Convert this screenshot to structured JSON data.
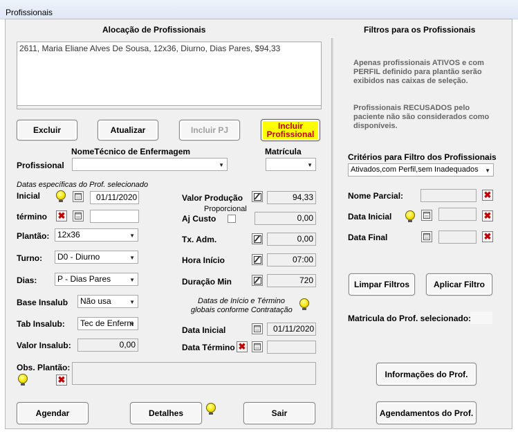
{
  "window": {
    "title": "Profissionais"
  },
  "alloc": {
    "heading": "Alocação de Profissionais",
    "list_item": "2611, Maria Eliane Alves De Sousa, 12x36, Diurno, Dias Pares, $94,33"
  },
  "buttons": {
    "excluir": "Excluir",
    "atualizar": "Atualizar",
    "incluir_pj": "Incluir PJ",
    "incluir_prof_1": "Incluir",
    "incluir_prof_2": "Profissional",
    "agendar": "Agendar",
    "detalhes": "Detalhes",
    "sair": "Sair",
    "limpar_filtros": "Limpar Filtros",
    "aplicar_filtro": "Aplicar Filtro",
    "info_prof": "Informações do Prof.",
    "agend_prof": "Agendamentos do Prof."
  },
  "form": {
    "nome_tecnico": "NomeTécnico de Enfermagem",
    "profissional": "Profissional",
    "matricula": "Matrícula",
    "datas_especificas": "Datas específicas do Prof. selecionado",
    "inicial": "Inicial",
    "inicial_value": "01/11/2020",
    "termino": "término",
    "termino_value": "",
    "plantao": "Plantão:",
    "plantao_value": "12x36",
    "turno": "Turno:",
    "turno_value": "D0 - Diurno",
    "dias": "Dias:",
    "dias_value": "P - Dias Pares",
    "base_insalub": "Base Insalub",
    "base_insalub_value": "Não usa",
    "tab_insalub": "Tab Insalub:",
    "tab_insalub_value": "Tec de Enferm",
    "valor_insalub": "Valor Insalub:",
    "valor_insalub_value": "0,00",
    "obs_plantao": "Obs. Plantão:",
    "valor_producao": "Valor Produção",
    "valor_producao_value": "94,33",
    "proporcional": "Proporcional",
    "aj_custo": "Aj Custo",
    "aj_custo_value": "0,00",
    "tx_adm": "Tx. Adm.",
    "tx_adm_value": "0,00",
    "hora_inicio": "Hora Início",
    "hora_inicio_value": "07:00",
    "duracao_min": "Duração Min",
    "duracao_min_value": "720",
    "datas_globais_1": "Datas de Início e Término",
    "datas_globais_2": "globais conforme Contratação",
    "data_inicial": "Data Inicial",
    "data_inicial_value": "01/11/2020",
    "data_termino": "Data Término",
    "data_termino_value": ""
  },
  "filters": {
    "heading": "Filtros para os Profissionais",
    "info1": "Apenas profissionais ATIVOS e com PERFIL definido para plantão serão exibidos nas caixas de seleção.",
    "info2": "Profissionais RECUSADOS pelo paciente não são considerados como disponíveis.",
    "criterios": "Critérios para Filtro dos Profissionais",
    "criterios_value": "Ativados,com Perfil,sem Inadequados",
    "nome_parcial": "Nome Parcial:",
    "data_inicial": "Data Inicial",
    "data_final": "Data Final",
    "matricula_sel": "Matricula do Prof. selecionado:"
  }
}
